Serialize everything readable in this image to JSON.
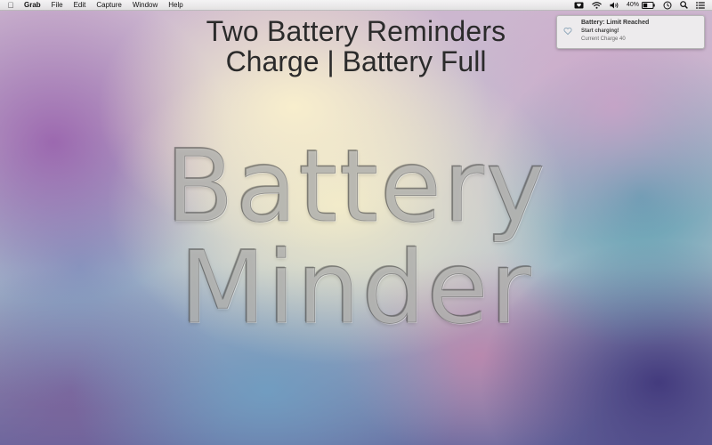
{
  "menubar": {
    "apple_icon": "apple-icon",
    "items": [
      "Grab",
      "File",
      "Edit",
      "Capture",
      "Window",
      "Help"
    ],
    "status": {
      "battery_percent": "40%",
      "icons": [
        "battery-minder-icon",
        "wifi-icon",
        "volume-icon",
        "battery-icon",
        "time-machine-icon",
        "search-icon",
        "notification-center-icon"
      ]
    }
  },
  "headline": {
    "line1": "Two Battery Reminders",
    "line2": "Charge | Battery Full"
  },
  "logo": {
    "line1": "Battery",
    "line2": "Minder"
  },
  "notification": {
    "icon": "heart-icon",
    "title": "Battery: Limit Reached",
    "subtitle": "Start charging!",
    "body": "Current Charge 40"
  }
}
